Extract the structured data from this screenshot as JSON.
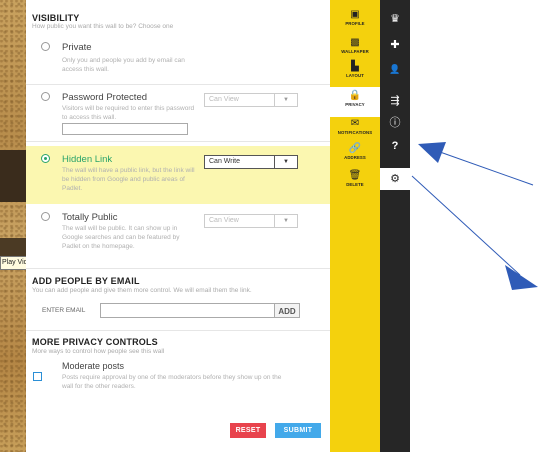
{
  "visibility": {
    "title": "VISIBILITY",
    "subtitle": "How public you want this wall to be? Choose one",
    "options": [
      {
        "label": "Private",
        "desc": "Only you and people you add by email can access this wall.",
        "selected": false
      },
      {
        "label": "Password Protected",
        "desc": "Visitors will be required to enter this password to access this wall.",
        "select": "Can View",
        "selected": false
      },
      {
        "label": "Hidden Link",
        "desc": "The wall will have a public link, but the link will be hidden from Google and public areas of Padlet.",
        "select": "Can Write",
        "selected": true
      },
      {
        "label": "Totally Public",
        "desc": "The wall will be public. It can show up in Google searches and can be featured by Padlet on the homepage.",
        "select": "Can View",
        "selected": false
      }
    ]
  },
  "tooltip": "Play Video",
  "add_people": {
    "title": "ADD PEOPLE BY EMAIL",
    "subtitle": "You can add people and give them more control. We will email them the link.",
    "email_label": "ENTER EMAIL",
    "add_label": "ADD"
  },
  "privacy_controls": {
    "title": "MORE PRIVACY CONTROLS",
    "subtitle": "More ways to control how people see this wall",
    "moderate_label": "Moderate posts",
    "moderate_desc": "Posts require approval by one of the moderators before they show up on the wall for the other readers."
  },
  "buttons": {
    "reset": "RESET",
    "submit": "SUBMIT"
  },
  "tabs": [
    {
      "label": "PROFILE",
      "icon": "id-card-icon",
      "glyph": "▣"
    },
    {
      "label": "WALLPAPER",
      "icon": "image-icon",
      "glyph": "▩"
    },
    {
      "label": "LAYOUT",
      "icon": "layout-icon",
      "glyph": "▙"
    },
    {
      "label": "PRIVACY",
      "icon": "lock-icon",
      "glyph": "🔒"
    },
    {
      "label": "NOTIFICATIONS",
      "icon": "envelope-icon",
      "glyph": "✉"
    },
    {
      "label": "ADDRESS",
      "icon": "link-icon",
      "glyph": "🔗"
    },
    {
      "label": "DELETE",
      "icon": "trash-icon",
      "glyph": "🗑"
    }
  ],
  "toolbar": [
    {
      "icon": "crown-icon",
      "glyph": "♛"
    },
    {
      "icon": "plus-icon",
      "glyph": "✚"
    },
    {
      "icon": "user-icon",
      "glyph": "👤"
    },
    {
      "icon": "share-icon",
      "glyph": "⇶"
    },
    {
      "icon": "info-icon",
      "glyph": "ⓘ"
    },
    {
      "icon": "help-icon",
      "glyph": "?"
    },
    {
      "icon": "gear-icon",
      "glyph": "⚙"
    }
  ],
  "colors": {
    "accent_yellow": "#f4d10d",
    "dark_bar": "#262626",
    "selected_green": "#2aa36a",
    "reset_red": "#e8434d",
    "submit_blue": "#43a9ea",
    "highlight": "#fbf7b0",
    "arrow_blue": "#2f5bb7"
  }
}
